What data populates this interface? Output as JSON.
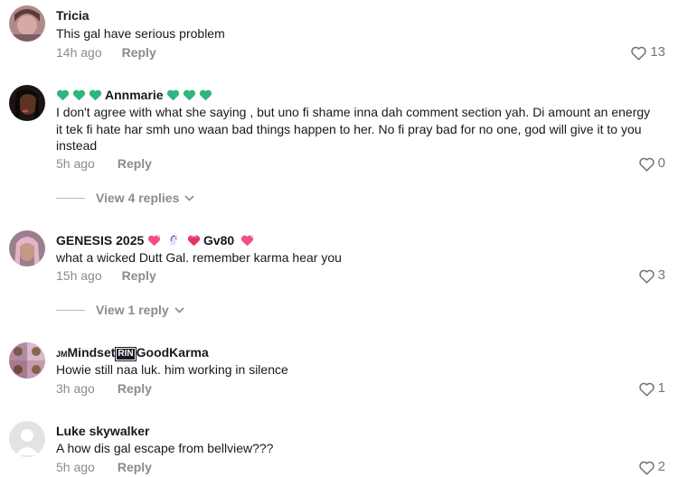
{
  "comments": [
    {
      "username": "Tricia",
      "text": "This gal have serious problem",
      "time": "14h ago",
      "reply_label": "Reply",
      "likes": "13"
    },
    {
      "username": "Annmarie",
      "username_emoji": "green-heart",
      "text": "I don't agree with what she saying , but uno fi shame inna dah comment section yah. Di amount an energy it tek fi hate har smh uno waan bad things happen to her. No fi pray bad for no one, god will give it to you instead",
      "time": "5h ago",
      "reply_label": "Reply",
      "likes": "0",
      "view_replies": "View 4 replies"
    },
    {
      "username_part1": "GENESIS 2025",
      "username_part2": "Gv80",
      "text": "what a wicked Dutt Gal. remember karma hear you",
      "time": "15h ago",
      "reply_label": "Reply",
      "likes": "3",
      "view_replies": "View 1 reply"
    },
    {
      "username_prefix": "JM",
      "username_part1": "Mindset",
      "username_box": "RIN",
      "username_part2": "GoodKarma",
      "text": "Howie still naa luk. him working in silence",
      "time": "3h ago",
      "reply_label": "Reply",
      "likes": "1"
    },
    {
      "username": "Luke skywalker",
      "text": "A how dis gal escape from bellview???",
      "time": "5h ago",
      "reply_label": "Reply",
      "likes": "2"
    }
  ],
  "colors": {
    "text": "#161823",
    "meta": "#8a8b91",
    "green_heart": "#2fb67e",
    "pink_heart": "#f24e8b"
  }
}
